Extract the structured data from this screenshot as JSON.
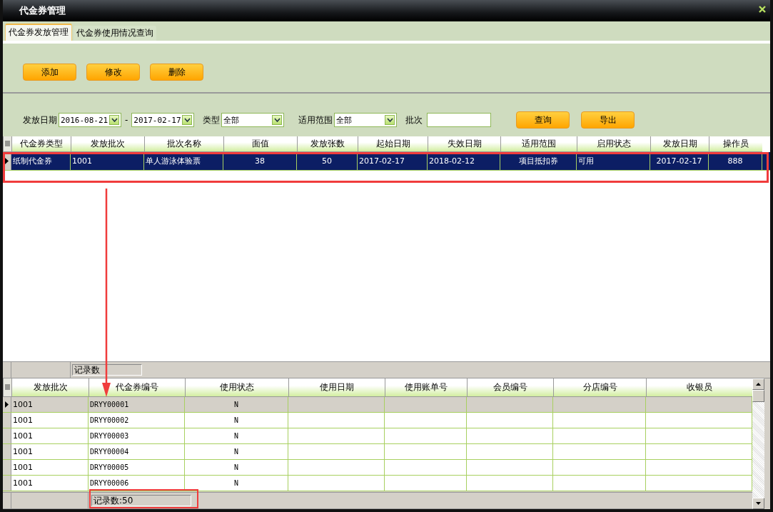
{
  "window": {
    "title": "代金券管理"
  },
  "tabs": [
    {
      "label": "代金券发放管理",
      "selected": true
    },
    {
      "label": "代金券使用情况查询",
      "selected": false
    }
  ],
  "toolbar": {
    "buttons": [
      "添加",
      "修改",
      "删除"
    ]
  },
  "filter": {
    "date_label": "发放日期",
    "date_from": "2016-08-21",
    "date_separator": "-",
    "date_to": "2017-02-17",
    "type_label": "类型",
    "type_value": "全部",
    "scope_label": "适用范围",
    "scope_value": "全部",
    "batch_label": "批次",
    "buttons": [
      "查询",
      "导出"
    ]
  },
  "batch_grid": {
    "columns": [
      "代金券类型",
      "发放批次",
      "批次名称",
      "面值",
      "发放张数",
      "起始日期",
      "失效日期",
      "适用范围",
      "启用状态",
      "发放日期",
      "操作员"
    ],
    "rows": [
      {
        "selected": true,
        "cells": [
          "纸制代金券",
          "1001",
          "单人游泳体验票",
          "38",
          "50",
          "2017-02-17",
          "2018-02-12",
          "项目抵扣券",
          "可用",
          "2017-02-17",
          "888"
        ]
      }
    ],
    "footer": "记录数"
  },
  "voucher_grid": {
    "columns": [
      "发放批次",
      "代金券编号",
      "使用状态",
      "使用日期",
      "使用账单号",
      "会员编号",
      "分店编号",
      "收银员"
    ],
    "rows": [
      {
        "selected": true,
        "cells": [
          "1001",
          "DRYY00001",
          "N"
        ]
      },
      {
        "selected": false,
        "cells": [
          "1001",
          "DRYY00002",
          "N"
        ]
      },
      {
        "selected": false,
        "cells": [
          "1001",
          "DRYY00003",
          "N"
        ]
      },
      {
        "selected": false,
        "cells": [
          "1001",
          "DRYY00004",
          "N"
        ]
      },
      {
        "selected": false,
        "cells": [
          "1001",
          "DRYY00005",
          "N"
        ]
      },
      {
        "selected": false,
        "cells": [
          "1001",
          "DRYY00006",
          "N"
        ]
      }
    ],
    "footer": "记录数:50"
  }
}
